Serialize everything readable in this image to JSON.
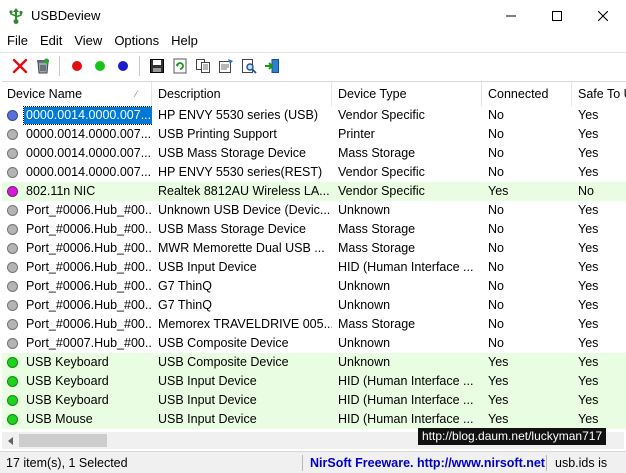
{
  "window": {
    "title": "USBDeview"
  },
  "menu": [
    "File",
    "Edit",
    "View",
    "Options",
    "Help"
  ],
  "toolbar": {
    "buttons": [
      "disconnect-icon",
      "uninstall-icon",
      "red-dot-icon",
      "green-dot-icon",
      "blue-dot-icon",
      "save-icon",
      "refresh-icon",
      "copy-icon",
      "properties-icon",
      "search-icon",
      "exit-icon"
    ]
  },
  "table": {
    "columns": [
      "Device Name",
      "Description",
      "Device Type",
      "Connected",
      "Safe To U"
    ],
    "rows": [
      {
        "name": "0000.0014.0000.007....",
        "desc": "HP ENVY 5530 series (USB)",
        "type": "Vendor Specific",
        "connected": "No",
        "safe": "Yes",
        "color": "#5a6fd8",
        "selected": true,
        "hl": false
      },
      {
        "name": "0000.0014.0000.007....",
        "desc": "USB Printing Support",
        "type": "Printer",
        "connected": "No",
        "safe": "Yes",
        "color": "#b4b4b4",
        "selected": false,
        "hl": false
      },
      {
        "name": "0000.0014.0000.007....",
        "desc": "USB Mass Storage Device",
        "type": "Mass Storage",
        "connected": "No",
        "safe": "Yes",
        "color": "#b4b4b4",
        "selected": false,
        "hl": false
      },
      {
        "name": "0000.0014.0000.007....",
        "desc": "HP ENVY 5530 series(REST)",
        "type": "Vendor Specific",
        "connected": "No",
        "safe": "Yes",
        "color": "#b4b4b4",
        "selected": false,
        "hl": false
      },
      {
        "name": "802.11n NIC",
        "desc": "Realtek 8812AU Wireless LA...",
        "type": "Vendor Specific",
        "connected": "Yes",
        "safe": "No",
        "color": "#d21ed2",
        "selected": false,
        "hl": true
      },
      {
        "name": "Port_#0006.Hub_#00...",
        "desc": "Unknown USB Device (Devic...",
        "type": "Unknown",
        "connected": "No",
        "safe": "Yes",
        "color": "#b4b4b4",
        "selected": false,
        "hl": false
      },
      {
        "name": "Port_#0006.Hub_#00...",
        "desc": "USB Mass Storage Device",
        "type": "Mass Storage",
        "connected": "No",
        "safe": "Yes",
        "color": "#b4b4b4",
        "selected": false,
        "hl": false
      },
      {
        "name": "Port_#0006.Hub_#00...",
        "desc": "MWR Memorette Dual USB ...",
        "type": "Mass Storage",
        "connected": "No",
        "safe": "Yes",
        "color": "#b4b4b4",
        "selected": false,
        "hl": false
      },
      {
        "name": "Port_#0006.Hub_#00...",
        "desc": "USB Input Device",
        "type": "HID (Human Interface ...",
        "connected": "No",
        "safe": "Yes",
        "color": "#b4b4b4",
        "selected": false,
        "hl": false
      },
      {
        "name": "Port_#0006.Hub_#00...",
        "desc": "G7 ThinQ",
        "type": "Unknown",
        "connected": "No",
        "safe": "Yes",
        "color": "#b4b4b4",
        "selected": false,
        "hl": false
      },
      {
        "name": "Port_#0006.Hub_#00...",
        "desc": "G7 ThinQ",
        "type": "Unknown",
        "connected": "No",
        "safe": "Yes",
        "color": "#b4b4b4",
        "selected": false,
        "hl": false
      },
      {
        "name": "Port_#0006.Hub_#00...",
        "desc": "Memorex TRAVELDRIVE 005...",
        "type": "Mass Storage",
        "connected": "No",
        "safe": "Yes",
        "color": "#b4b4b4",
        "selected": false,
        "hl": false
      },
      {
        "name": "Port_#0007.Hub_#00...",
        "desc": "USB Composite Device",
        "type": "Unknown",
        "connected": "No",
        "safe": "Yes",
        "color": "#b4b4b4",
        "selected": false,
        "hl": false
      },
      {
        "name": "USB Keyboard",
        "desc": "USB Composite Device",
        "type": "Unknown",
        "connected": "Yes",
        "safe": "Yes",
        "color": "#1ed21e",
        "selected": false,
        "hl": true
      },
      {
        "name": "USB Keyboard",
        "desc": "USB Input Device",
        "type": "HID (Human Interface ...",
        "connected": "Yes",
        "safe": "Yes",
        "color": "#1ed21e",
        "selected": false,
        "hl": true
      },
      {
        "name": "USB Keyboard",
        "desc": "USB Input Device",
        "type": "HID (Human Interface ...",
        "connected": "Yes",
        "safe": "Yes",
        "color": "#1ed21e",
        "selected": false,
        "hl": true
      },
      {
        "name": "USB Mouse",
        "desc": "USB Input Device",
        "type": "HID (Human Interface ...",
        "connected": "Yes",
        "safe": "Yes",
        "color": "#1ed21e",
        "selected": false,
        "hl": true
      }
    ]
  },
  "watermark": "http://blog.daum.net/luckyman717",
  "status": {
    "count": "17 item(s), 1 Selected",
    "credit": "NirSoft Freeware.  http://www.nirsoft.net",
    "note": "usb.ids is"
  }
}
